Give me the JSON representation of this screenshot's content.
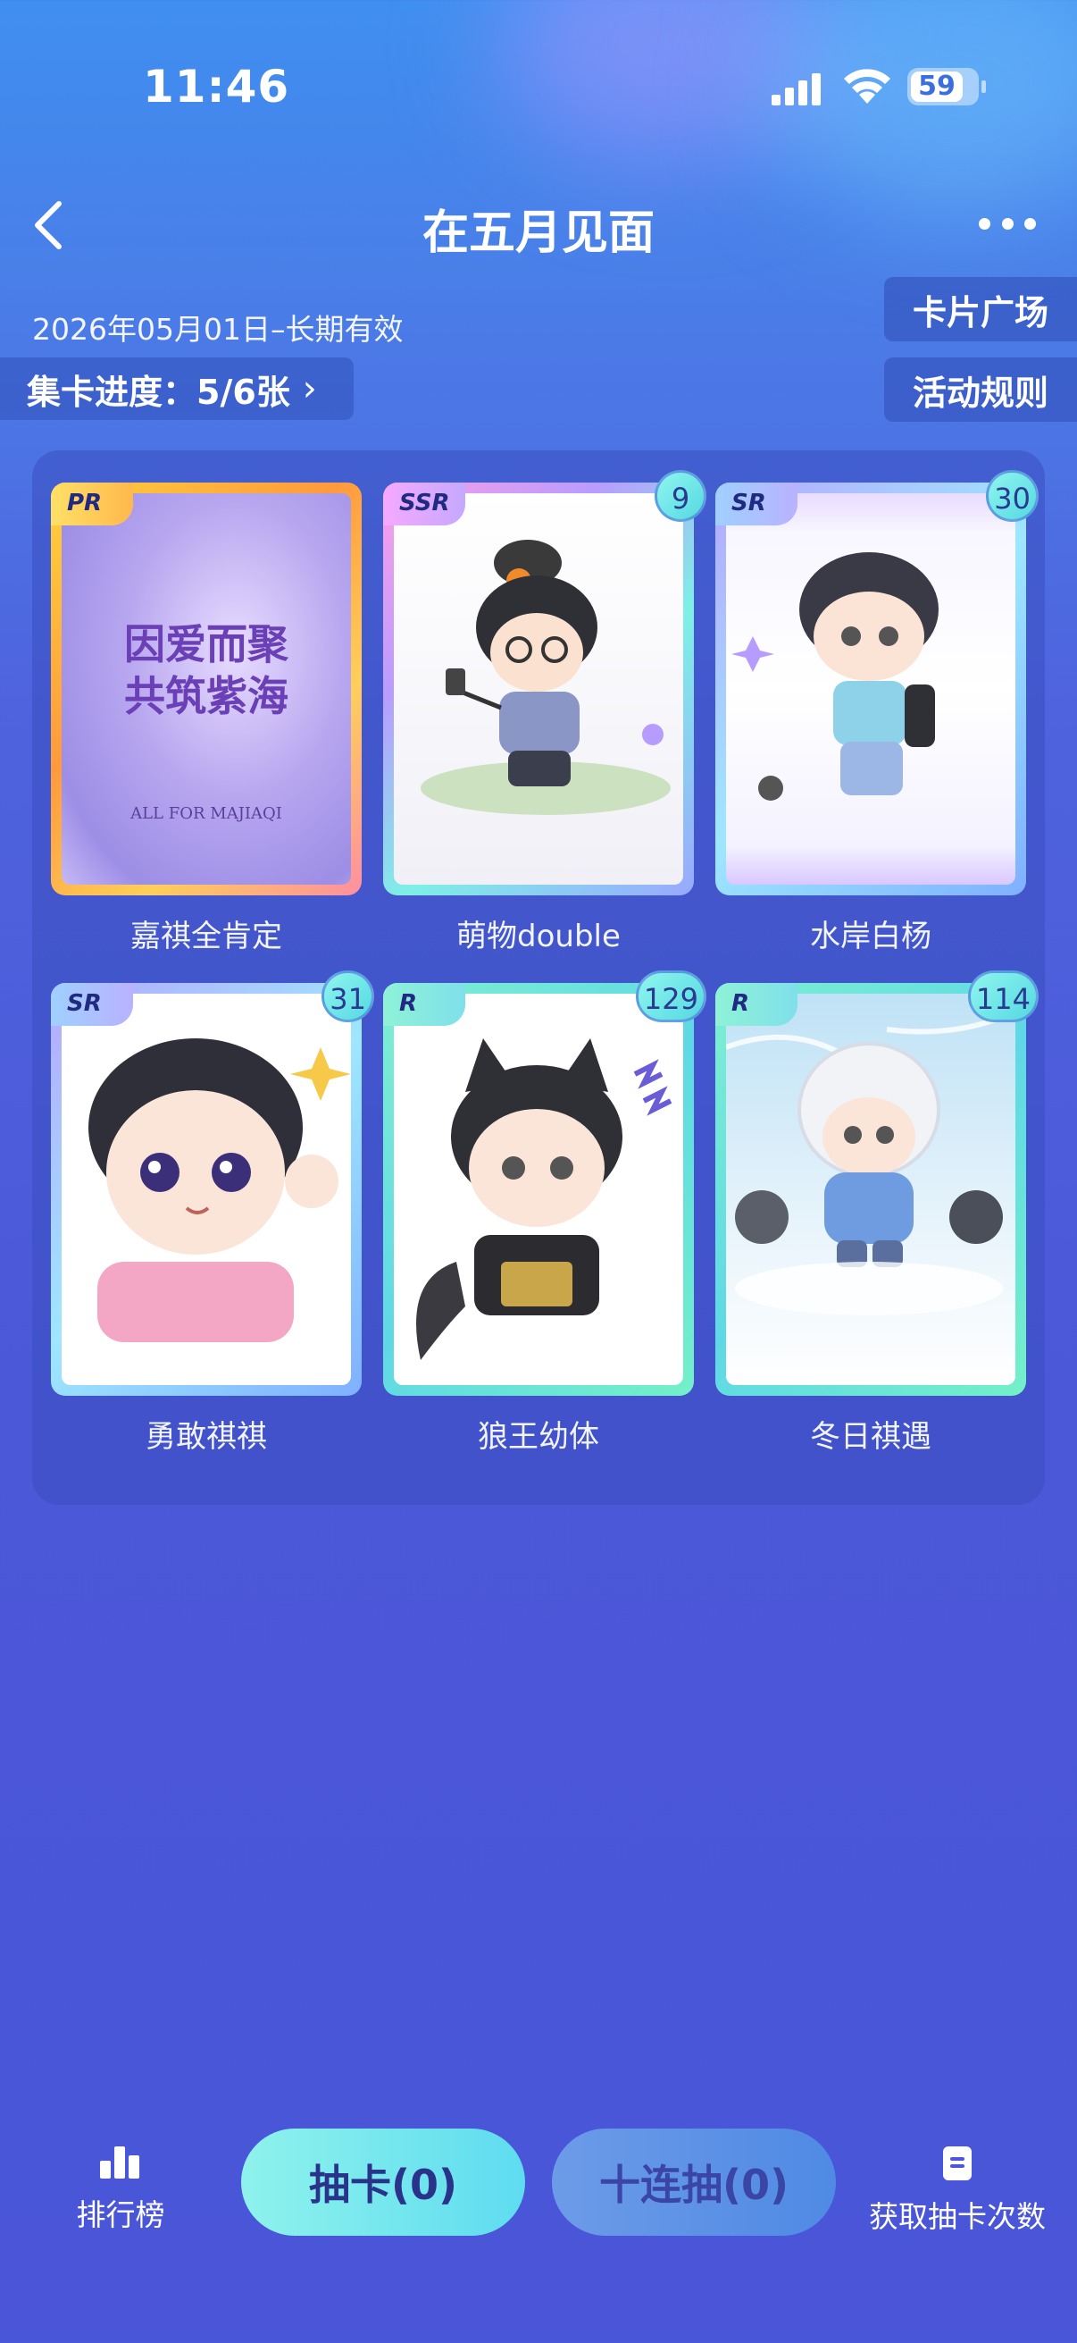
{
  "status_bar": {
    "time": "11:46",
    "battery": "59"
  },
  "header": {
    "title": "在五月见面"
  },
  "event": {
    "date_range": "2026年05月01日–长期有效",
    "progress_label": "集卡进度：5/6张",
    "card_plaza": "卡片广场",
    "rules": "活动规则"
  },
  "cards": [
    {
      "name": "嘉祺全肯定",
      "rarity": "PR",
      "count": "",
      "art_text_1": "因爱而聚",
      "art_text_2": "共筑紫海",
      "art_sub": "ALL FOR MAJIAQI"
    },
    {
      "name": "萌物double",
      "rarity": "SSR",
      "count": "9"
    },
    {
      "name": "水岸白杨",
      "rarity": "SR",
      "count": "30"
    },
    {
      "name": "勇敢祺祺",
      "rarity": "SR",
      "count": "31"
    },
    {
      "name": "狼王幼体",
      "rarity": "R",
      "count": "129"
    },
    {
      "name": "冬日祺遇",
      "rarity": "R",
      "count": "114"
    }
  ],
  "bottom_bar": {
    "leaderboard": "排行榜",
    "draw_one": "抽卡(0)",
    "draw_ten": "十连抽(0)",
    "get_draws": "获取抽卡次数"
  },
  "colors": {
    "accent_cyan": "#5edcf0",
    "panel": "#3a4ec0",
    "background": "#4b58d8"
  }
}
